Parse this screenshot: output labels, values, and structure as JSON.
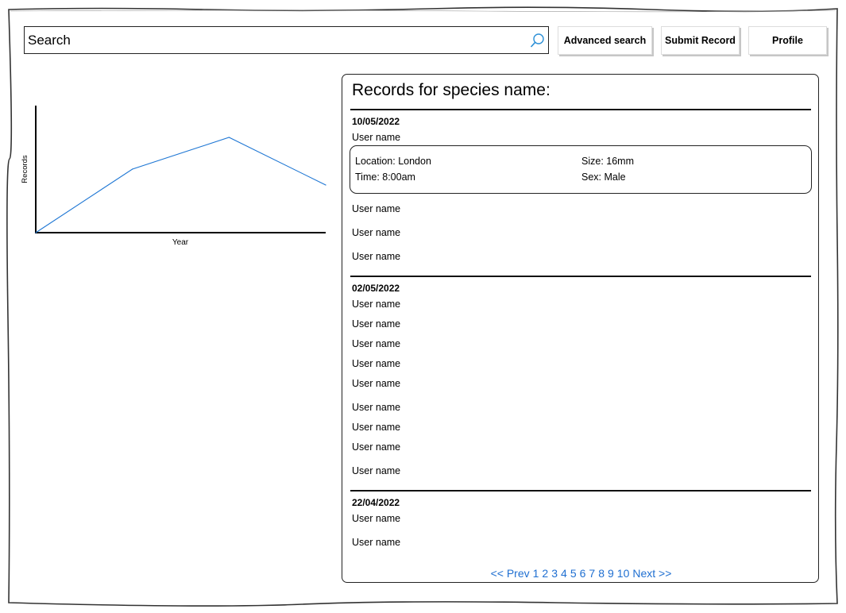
{
  "search": {
    "placeholder": "Search"
  },
  "toolbar": {
    "advanced_search_label": "Advanced search",
    "submit_record_label": "Submit Record",
    "profile_label": "Profile"
  },
  "chart_data": {
    "type": "line",
    "xlabel": "Year",
    "ylabel": "Records",
    "x": [
      0,
      1,
      2,
      3
    ],
    "series": [
      {
        "values": [
          0,
          2,
          3,
          1.5
        ]
      }
    ],
    "ylim": [
      0,
      4
    ],
    "grid": false,
    "color": "#1f77d4"
  },
  "records": {
    "title": "Records for species name:",
    "groups": [
      {
        "date": "10/05/2022",
        "users": [
          "User name",
          "User name",
          "User name",
          "User name"
        ],
        "detail": {
          "location": "Location: London",
          "time": "Time: 8:00am",
          "size": "Size: 16mm",
          "sex": "Sex: Male"
        }
      },
      {
        "date": "02/05/2022",
        "users": [
          "User name",
          "User name",
          "User name",
          "User name",
          "User name",
          "User name",
          "User name",
          "User name",
          "User name"
        ]
      },
      {
        "date": "22/04/2022",
        "users": [
          "User name",
          "User name"
        ]
      }
    ]
  },
  "pagination": {
    "prev": "<< Prev",
    "pages": [
      "1",
      "2",
      "3",
      "4",
      "5",
      "6",
      "7",
      "8",
      "9",
      "10"
    ],
    "next": "Next >>",
    "color": "#1f6fd1"
  }
}
